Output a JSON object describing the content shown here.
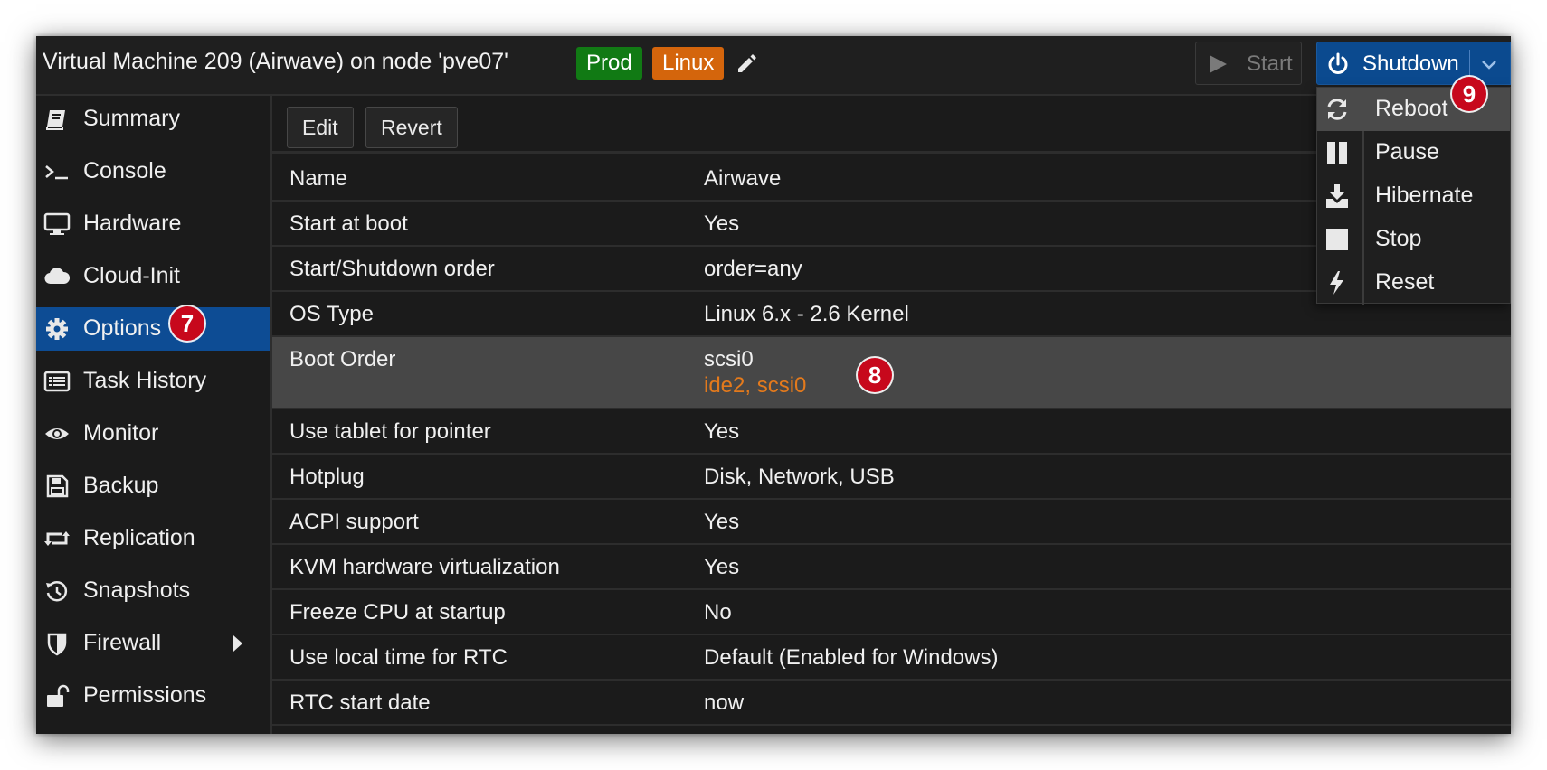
{
  "header": {
    "title": "Virtual Machine 209 (Airwave) on node 'pve07'",
    "tags": [
      "Prod",
      "Linux"
    ],
    "tag_colors": {
      "Prod": "#117a14",
      "Linux": "#d4650c"
    },
    "edit_tags_icon": "pencil-icon",
    "start_label": "Start",
    "shutdown_label": "Shutdown"
  },
  "sidebar": {
    "items": [
      {
        "label": "Summary",
        "icon": "book-icon"
      },
      {
        "label": "Console",
        "icon": "terminal-icon"
      },
      {
        "label": "Hardware",
        "icon": "monitor-icon"
      },
      {
        "label": "Cloud-Init",
        "icon": "cloud-icon"
      },
      {
        "label": "Options",
        "icon": "gear-icon",
        "active": true
      },
      {
        "label": "Task History",
        "icon": "list-icon"
      },
      {
        "label": "Monitor",
        "icon": "eye-icon"
      },
      {
        "label": "Backup",
        "icon": "floppy-icon"
      },
      {
        "label": "Replication",
        "icon": "retweet-icon"
      },
      {
        "label": "Snapshots",
        "icon": "history-icon"
      },
      {
        "label": "Firewall",
        "icon": "shield-icon",
        "has_submenu": true
      },
      {
        "label": "Permissions",
        "icon": "unlock-icon"
      }
    ]
  },
  "toolbar": {
    "edit_label": "Edit",
    "revert_label": "Revert"
  },
  "options": {
    "rows": [
      {
        "key": "Name",
        "value": "Airwave"
      },
      {
        "key": "Start at boot",
        "value": "Yes"
      },
      {
        "key": "Start/Shutdown order",
        "value": "order=any"
      },
      {
        "key": "OS Type",
        "value": "Linux 6.x - 2.6 Kernel"
      },
      {
        "key": "Boot Order",
        "value": "scsi0",
        "pending_value": "ide2, scsi0",
        "selected": true
      },
      {
        "key": "Use tablet for pointer",
        "value": "Yes"
      },
      {
        "key": "Hotplug",
        "value": "Disk, Network, USB"
      },
      {
        "key": "ACPI support",
        "value": "Yes"
      },
      {
        "key": "KVM hardware virtualization",
        "value": "Yes"
      },
      {
        "key": "Freeze CPU at startup",
        "value": "No"
      },
      {
        "key": "Use local time for RTC",
        "value": "Default (Enabled for Windows)"
      },
      {
        "key": "RTC start date",
        "value": "now"
      }
    ]
  },
  "shutdown_menu": {
    "items": [
      {
        "label": "Reboot",
        "icon": "refresh-icon",
        "hover": true
      },
      {
        "label": "Pause",
        "icon": "pause-icon"
      },
      {
        "label": "Hibernate",
        "icon": "download-icon"
      },
      {
        "label": "Stop",
        "icon": "stop-icon"
      },
      {
        "label": "Reset",
        "icon": "bolt-icon"
      }
    ]
  },
  "callouts": [
    "7",
    "8",
    "9"
  ],
  "colors": {
    "accent": "#0d4c94",
    "pending": "#e47a1c",
    "callout": "#c7081c"
  }
}
